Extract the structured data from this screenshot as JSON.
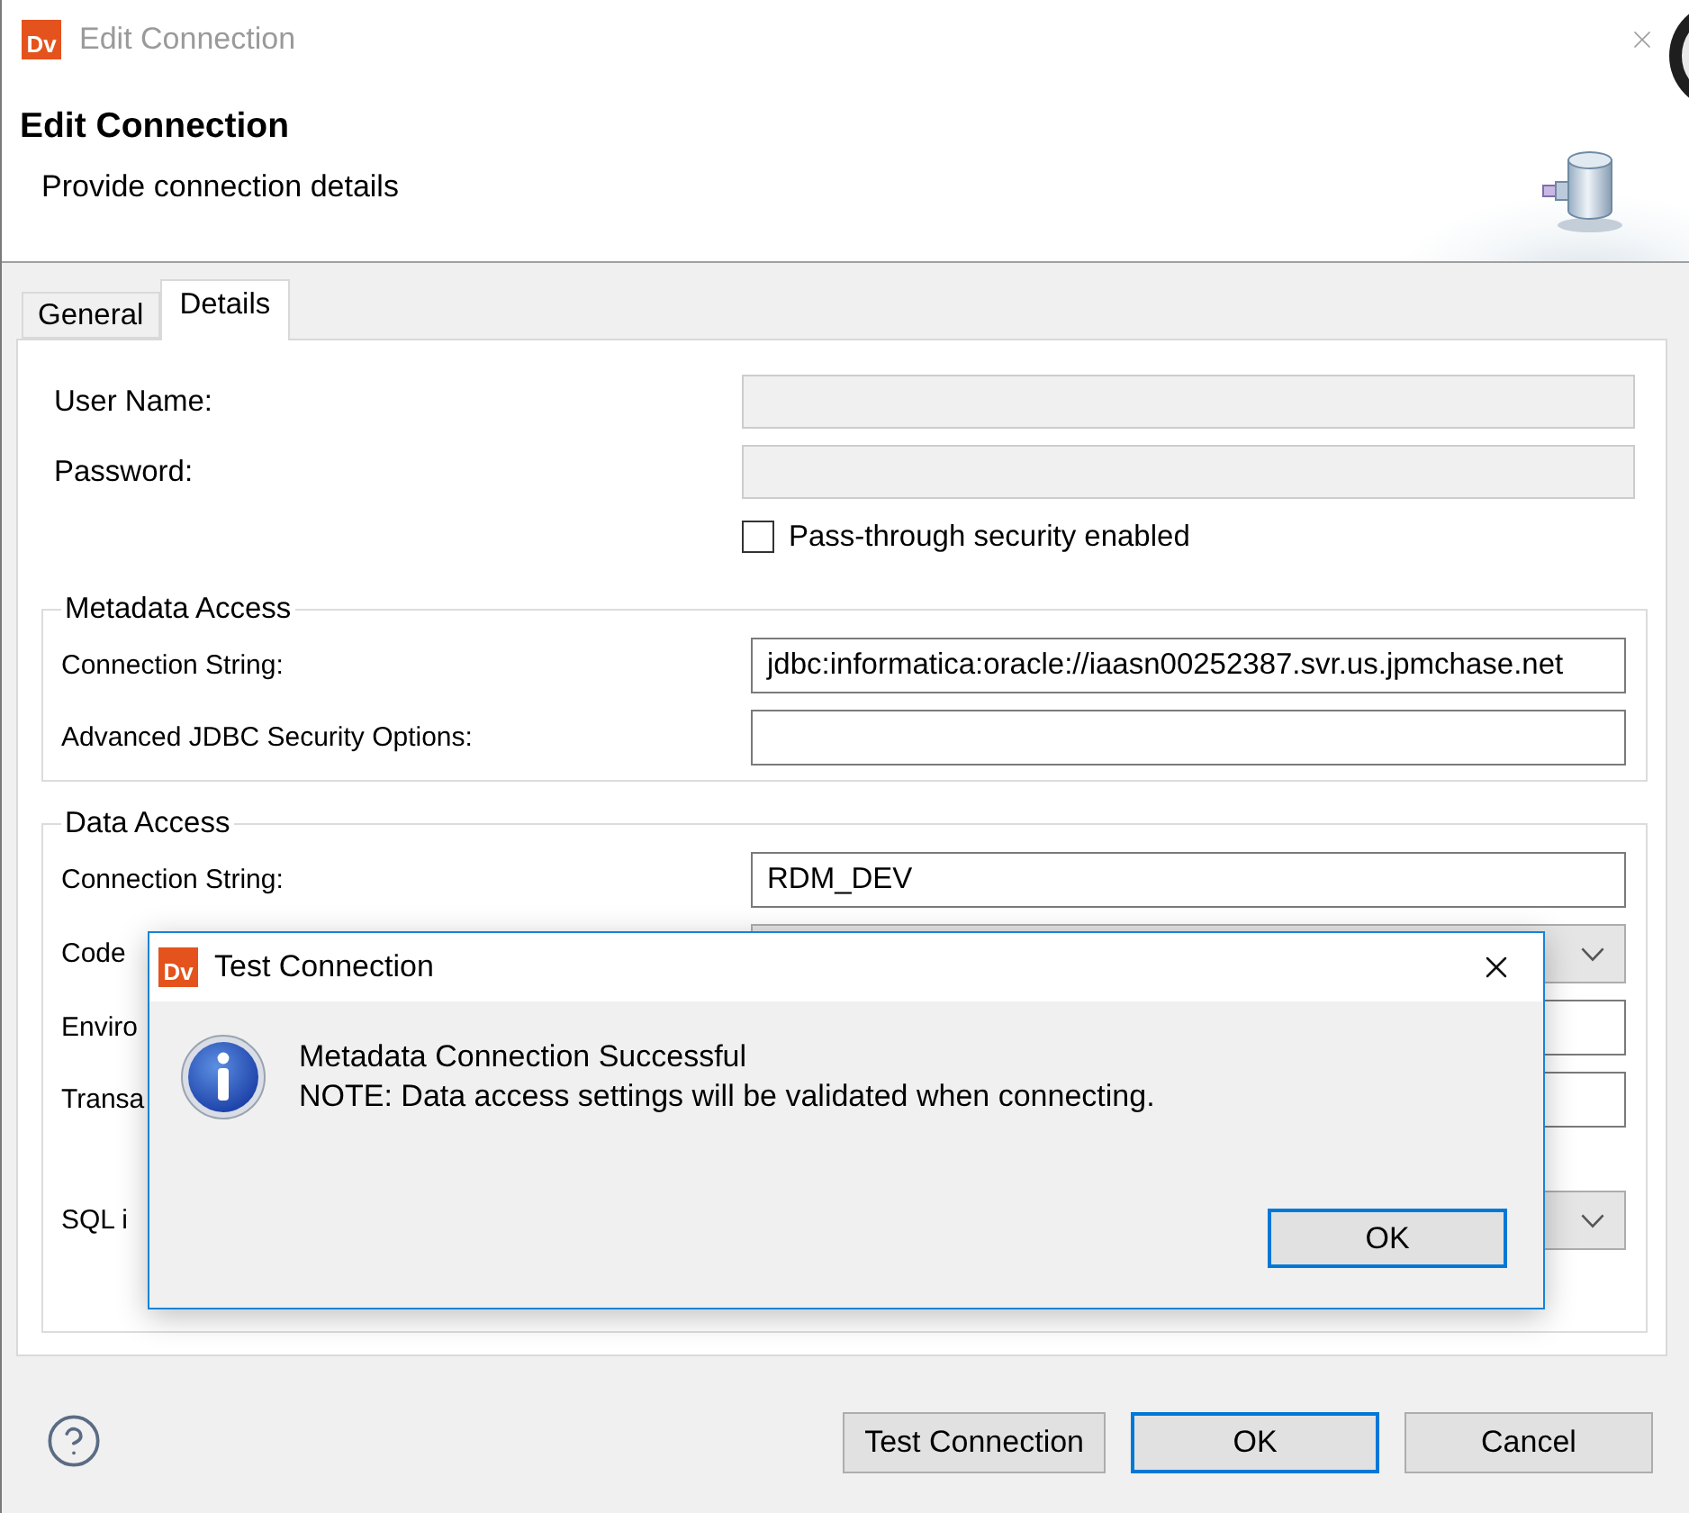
{
  "window": {
    "logo": "Dv",
    "title": "Edit Connection"
  },
  "header": {
    "title": "Edit Connection",
    "subtitle": "Provide connection details"
  },
  "tabs": [
    {
      "label": "General",
      "selected": false
    },
    {
      "label": "Details",
      "selected": true
    }
  ],
  "credentials": [
    {
      "label": "User Name:",
      "disabled": true
    },
    {
      "label": "Password:",
      "disabled": true
    }
  ],
  "pass_through": {
    "label": "Pass-through security enabled",
    "checked": false
  },
  "groups": [
    {
      "title": "Metadata Access",
      "fields": [
        {
          "kind": "text",
          "label": "Connection String:",
          "value": "jdbc:informatica:oracle://iaasn00252387.svr.us.jpmchase.net"
        },
        {
          "kind": "text",
          "label": "Advanced JDBC Security Options:"
        }
      ]
    },
    {
      "title": "Data Access",
      "fields": [
        {
          "kind": "text",
          "label": "Connection String:",
          "value": "RDM_DEV"
        },
        {
          "kind": "select",
          "label": "Code"
        },
        {
          "kind": "text",
          "label": "Enviro"
        },
        {
          "kind": "text",
          "label": "Transa"
        },
        {
          "kind": "select",
          "label": "SQL i"
        }
      ]
    }
  ],
  "footer": {
    "buttons": [
      {
        "label": "Test Connection",
        "default": false
      },
      {
        "label": "OK",
        "default": true
      },
      {
        "label": "Cancel",
        "default": false
      }
    ]
  },
  "dialog": {
    "logo": "Dv",
    "title": "Test Connection",
    "message": [
      "Metadata Connection Successful",
      "NOTE: Data access settings will be validated when connecting."
    ],
    "buttons": [
      {
        "label": "OK",
        "default": true
      }
    ]
  }
}
